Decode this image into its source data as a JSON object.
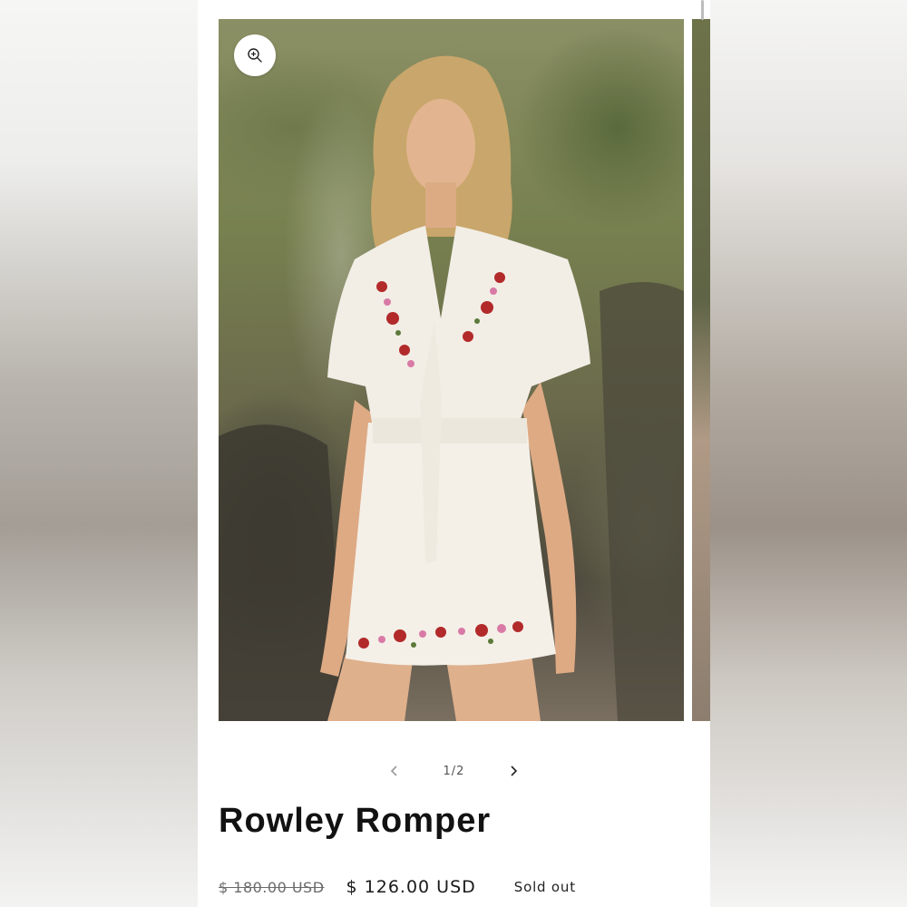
{
  "product": {
    "title": "Rowley Romper",
    "price_compare": "$ 180.00 USD",
    "price_sale": "$ 126.00 USD",
    "status_badge": "Sold out"
  },
  "gallery": {
    "counter": "1/2",
    "zoom_icon": "zoom-in-icon",
    "prev_icon": "chevron-left-icon",
    "next_icon": "chevron-right-icon"
  },
  "colors": {
    "background": "#ffffff",
    "text": "#121212",
    "muted": "#6b6b6b"
  }
}
